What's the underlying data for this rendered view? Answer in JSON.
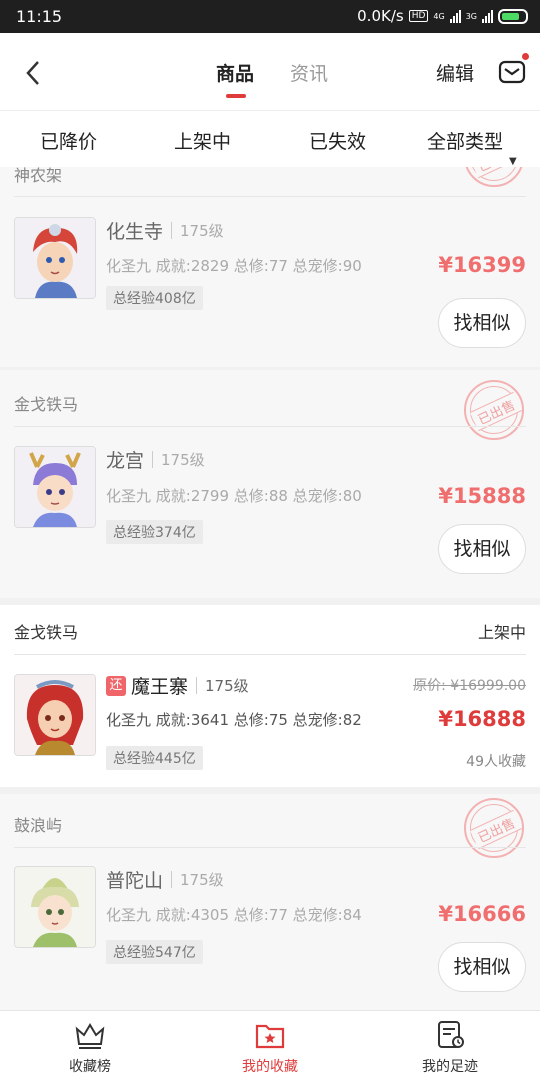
{
  "status_bar": {
    "time": "11:15",
    "speed": "0.0K/s",
    "hd": "HD",
    "net1": "4G",
    "net2": "3G"
  },
  "header": {
    "tabs": [
      {
        "label": "商品"
      },
      {
        "label": "资讯"
      }
    ],
    "edit_label": "编辑"
  },
  "filters": {
    "items": [
      "已降价",
      "上架中",
      "已失效"
    ],
    "type_label": "全部类型"
  },
  "listings": [
    {
      "server": "神农架",
      "sold_stamp": "已出售"
    },
    {
      "server": "",
      "school": "化生寺",
      "level": "175级",
      "stats": "化圣九 成就:2829 总修:77 总宠修:90",
      "exp": "总经验408亿",
      "price": "¥16399",
      "action": "找相似"
    },
    {
      "server": "金戈铁马",
      "sold_stamp": "已出售",
      "school": "龙宫",
      "level": "175级",
      "stats": "化圣九 成就:2799 总修:88 总宠修:80",
      "exp": "总经验374亿",
      "price": "¥15888",
      "action": "找相似"
    },
    {
      "server": "金戈铁马",
      "status": "上架中",
      "badge": "还",
      "school": "魔王寨",
      "level": "175级",
      "stats": "化圣九 成就:3641 总修:75 总宠修:82",
      "exp": "总经验445亿",
      "original_price": "原价: ¥16999.00",
      "price": "¥16888",
      "favorites": "49人收藏"
    },
    {
      "server": "鼓浪屿",
      "sold_stamp": "已出售",
      "school": "普陀山",
      "level": "175级",
      "stats": "化圣九 成就:4305 总修:77 总宠修:84",
      "exp": "总经验547亿",
      "price": "¥16666",
      "action": "找相似"
    }
  ],
  "bottom_nav": {
    "items": [
      {
        "label": "收藏榜"
      },
      {
        "label": "我的收藏"
      },
      {
        "label": "我的足迹"
      }
    ]
  },
  "colors": {
    "accent": "#e03b3b",
    "price_faded": "#f06e6e"
  }
}
